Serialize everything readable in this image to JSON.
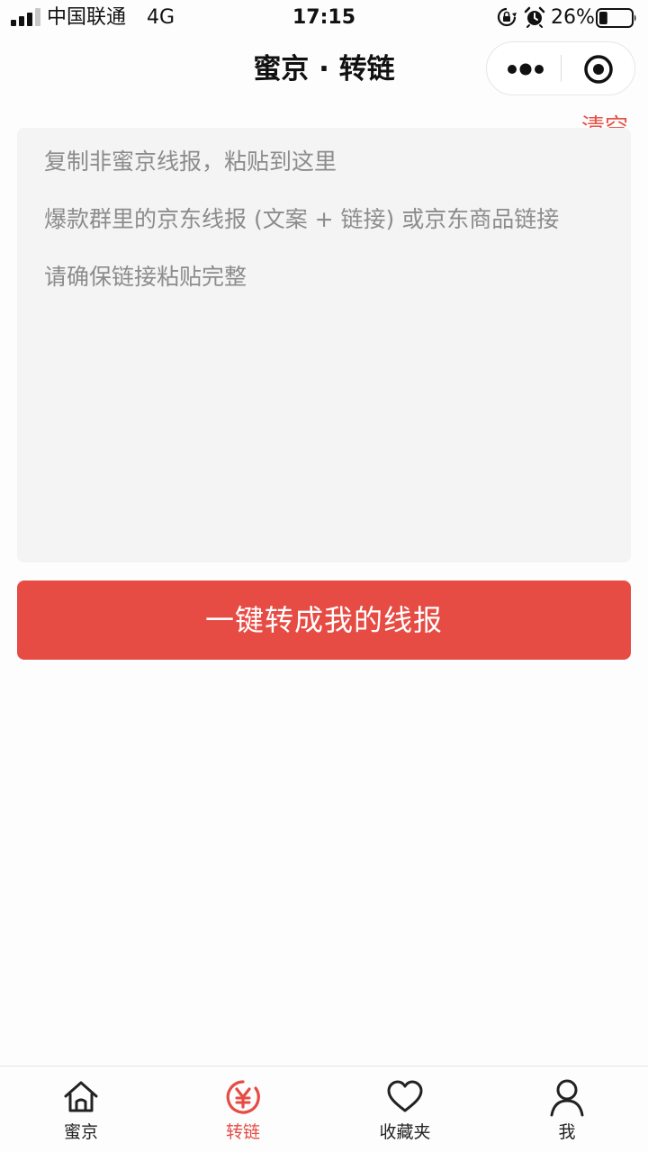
{
  "status_bar": {
    "carrier": "中国联通",
    "network": "4G",
    "time": "17:15",
    "battery_percent": "26%",
    "battery_level": 0.26
  },
  "nav": {
    "title": "蜜京 · 转链"
  },
  "editor": {
    "clear_label": "清空",
    "placeholder_lines": [
      "复制非蜜京线报，粘贴到这里",
      "爆款群里的京东线报 (文案 + 链接) 或京东商品链接",
      "请确保链接粘贴完整"
    ]
  },
  "convert_button_label": "一键转成我的线报",
  "tab_bar": {
    "items": [
      {
        "label": "蜜京",
        "icon": "home-icon",
        "active": false
      },
      {
        "label": "转链",
        "icon": "yen-circle-icon",
        "active": true
      },
      {
        "label": "收藏夹",
        "icon": "heart-icon",
        "active": false
      },
      {
        "label": "我",
        "icon": "user-icon",
        "active": false
      }
    ]
  },
  "colors": {
    "accent": "#e64c44",
    "clear_text": "#e8524a",
    "placeholder_text": "#8c8c8c",
    "textarea_bg": "#f4f4f4"
  }
}
